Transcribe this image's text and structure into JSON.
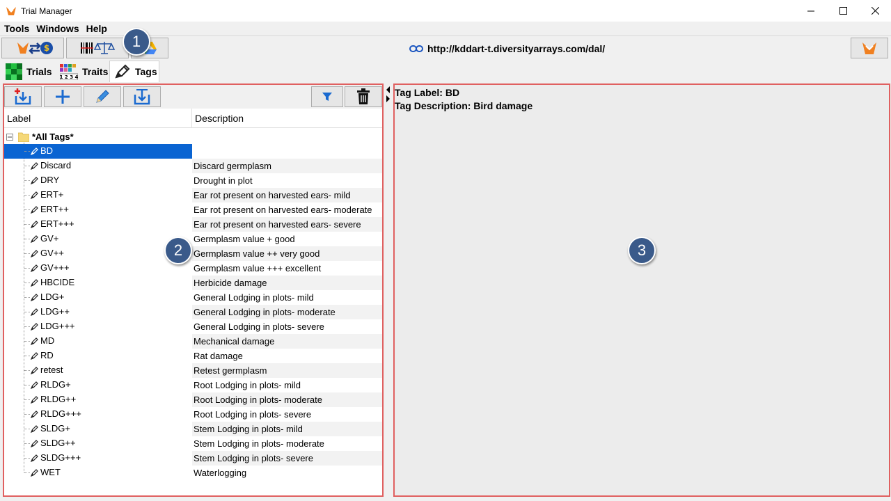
{
  "window": {
    "title": "Trial Manager"
  },
  "menu": [
    "Tools",
    "Windows",
    "Help"
  ],
  "toolbar": {
    "url": "http://kddart-t.diversityarrays.com/dal/"
  },
  "tabs": [
    {
      "label": "Trials"
    },
    {
      "label": "Traits"
    },
    {
      "label": "Tags"
    }
  ],
  "table": {
    "headers": [
      "Label",
      "Description"
    ],
    "root": "*All Tags*",
    "rows": [
      {
        "label": "BD",
        "desc": ""
      },
      {
        "label": "Discard",
        "desc": "Discard germplasm"
      },
      {
        "label": "DRY",
        "desc": "Drought in plot"
      },
      {
        "label": "ERT+",
        "desc": "Ear rot present on harvested ears- mild"
      },
      {
        "label": "ERT++",
        "desc": "Ear rot present on harvested ears- moderate"
      },
      {
        "label": "ERT+++",
        "desc": "Ear rot present on harvested ears- severe"
      },
      {
        "label": "GV+",
        "desc": "Germplasm value + good"
      },
      {
        "label": "GV++",
        "desc": "Germplasm value ++ very good"
      },
      {
        "label": "GV+++",
        "desc": "Germplasm value +++ excellent"
      },
      {
        "label": "HBCIDE",
        "desc": "Herbicide damage"
      },
      {
        "label": "LDG+",
        "desc": "General Lodging in plots- mild"
      },
      {
        "label": "LDG++",
        "desc": "General Lodging in plots- moderate"
      },
      {
        "label": "LDG+++",
        "desc": "General Lodging in plots- severe"
      },
      {
        "label": "MD",
        "desc": "Mechanical damage"
      },
      {
        "label": "RD",
        "desc": "Rat damage"
      },
      {
        "label": "retest",
        "desc": "Retest germplasm"
      },
      {
        "label": "RLDG+",
        "desc": "Root Lodging in plots- mild"
      },
      {
        "label": "RLDG++",
        "desc": "Root Lodging in plots- moderate"
      },
      {
        "label": "RLDG+++",
        "desc": "Root Lodging in plots- severe"
      },
      {
        "label": "SLDG+",
        "desc": "Stem Lodging in plots- mild"
      },
      {
        "label": "SLDG++",
        "desc": "Stem Lodging in plots- moderate"
      },
      {
        "label": "SLDG+++",
        "desc": "Stem Lodging in plots- severe"
      },
      {
        "label": "WET",
        "desc": "Waterlogging"
      }
    ]
  },
  "detail": {
    "tag_label": "Tag Label: BD",
    "tag_description": "Tag Description: Bird damage"
  },
  "callouts": [
    "1",
    "2",
    "3"
  ],
  "colors": {
    "selection": "#0a64d2",
    "highlight_border": "#e06060",
    "callout": "#3a5a8a"
  }
}
